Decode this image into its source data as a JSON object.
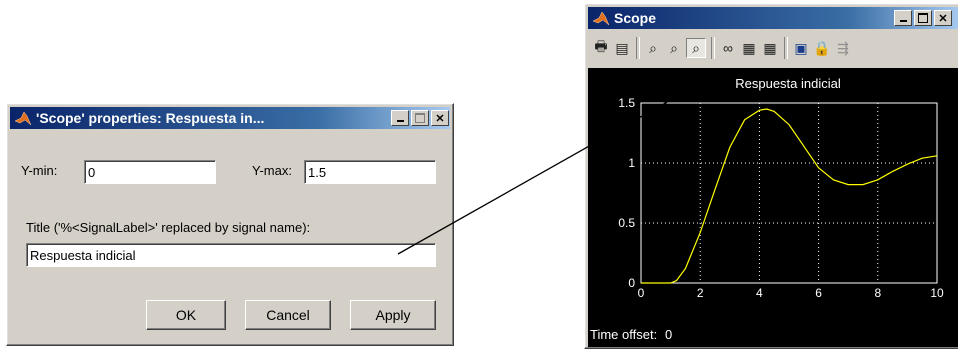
{
  "dialog": {
    "title": "'Scope' properties: Respuesta in...",
    "ymin_label": "Y-min:",
    "ymin_value": "0",
    "ymax_label": "Y-max:",
    "ymax_value": "1.5",
    "title_label": "Title ('%<SignalLabel>' replaced by signal name):",
    "title_value": "Respuesta indicial",
    "ok_label": "OK",
    "cancel_label": "Cancel",
    "apply_label": "Apply"
  },
  "scope": {
    "title": "Scope",
    "time_offset_label": "Time offset:",
    "time_offset_value": "0",
    "toolbar_icons": [
      "print-icon",
      "parameters-icon",
      "zoom-icon",
      "zoom-x-icon",
      "zoom-y-icon",
      "autoscale-binoculars-icon",
      "save-axes-icon",
      "restore-axes-icon",
      "floating-scope-icon",
      "lock-icon",
      "signal-selection-icon"
    ]
  },
  "chart_data": {
    "type": "line",
    "title": "Respuesta indicial",
    "xlim": [
      0,
      10
    ],
    "ylim": [
      0,
      1.5
    ],
    "xticks": [
      "0",
      "2",
      "4",
      "6",
      "8",
      "10"
    ],
    "yticks": [
      "0",
      "0.5",
      "1",
      "1.5"
    ],
    "grid": true,
    "background": "#000000",
    "line_color": "#ffff00",
    "series": [
      {
        "x": [
          0,
          1,
          1.2,
          1.5,
          2,
          2.5,
          3,
          3.5,
          4,
          4.25,
          4.5,
          5,
          5.5,
          6,
          6.5,
          7,
          7.5,
          8,
          8.5,
          9,
          9.5,
          10
        ],
        "values": [
          0,
          0,
          0.02,
          0.12,
          0.42,
          0.78,
          1.13,
          1.36,
          1.44,
          1.45,
          1.43,
          1.32,
          1.14,
          0.96,
          0.86,
          0.82,
          0.82,
          0.86,
          0.93,
          0.99,
          1.04,
          1.06
        ]
      }
    ]
  }
}
